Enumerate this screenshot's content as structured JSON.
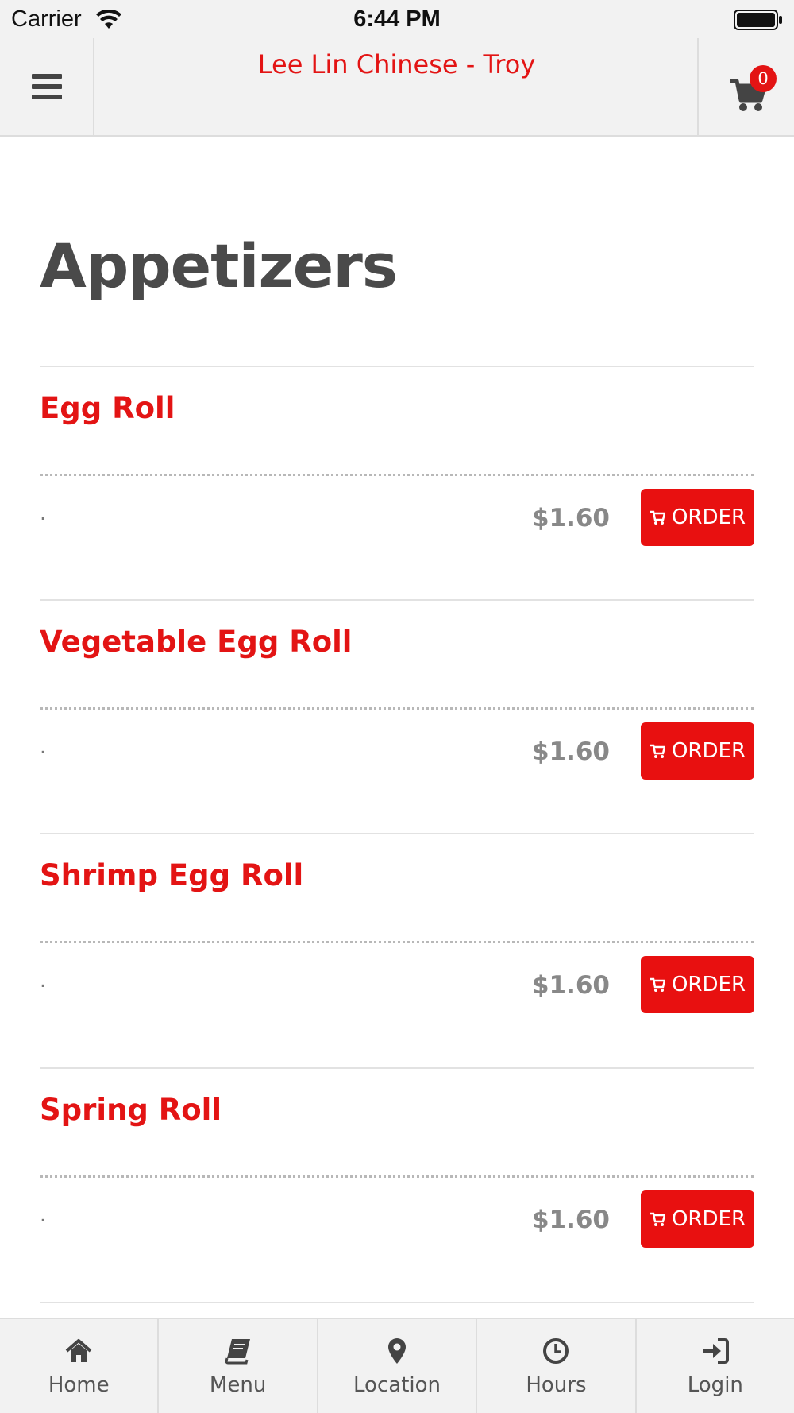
{
  "status_bar": {
    "carrier": "Carrier",
    "time": "6:44 PM"
  },
  "header": {
    "title": "Lee Lin Chinese - Troy",
    "cart_count": "0"
  },
  "page": {
    "title": "Appetizers"
  },
  "items": [
    {
      "name": "Egg Roll",
      "description": ".",
      "price": "$1.60",
      "order_label": "ORDER"
    },
    {
      "name": "Vegetable Egg Roll",
      "description": ".",
      "price": "$1.60",
      "order_label": "ORDER"
    },
    {
      "name": "Shrimp Egg Roll",
      "description": ".",
      "price": "$1.60",
      "order_label": "ORDER"
    },
    {
      "name": "Spring Roll",
      "description": ".",
      "price": "$1.60",
      "order_label": "ORDER"
    }
  ],
  "tabbar": {
    "tabs": [
      {
        "label": "Home",
        "icon": "home-icon"
      },
      {
        "label": "Menu",
        "icon": "book-icon"
      },
      {
        "label": "Location",
        "icon": "map-marker-icon"
      },
      {
        "label": "Hours",
        "icon": "clock-icon"
      },
      {
        "label": "Login",
        "icon": "sign-in-icon"
      }
    ]
  },
  "colors": {
    "accent": "#e31414",
    "header_bg": "#f2f2f2",
    "title_text": "#4a4a4a"
  }
}
